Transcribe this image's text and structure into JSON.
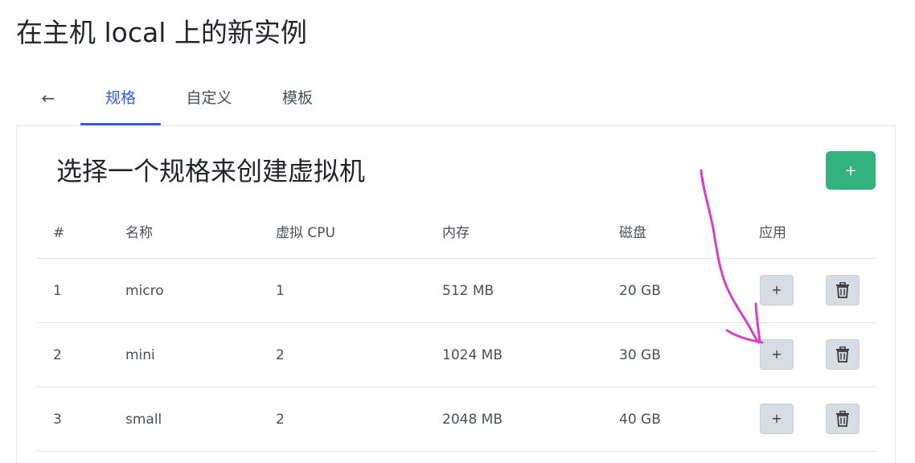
{
  "page": {
    "title": "在主机 local 上的新实例"
  },
  "tabs": {
    "back_label": "←",
    "items": [
      {
        "label": "规格"
      },
      {
        "label": "自定义"
      },
      {
        "label": "模板"
      }
    ],
    "active": "规格"
  },
  "card": {
    "title": "选择一个规格来创建虚拟机",
    "add_button_label": "+"
  },
  "table": {
    "headers": [
      "#",
      "名称",
      "虚拟 CPU",
      "内存",
      "磁盘",
      "应用"
    ],
    "rows": [
      {
        "index": "1",
        "name": "micro",
        "vcpu": "1",
        "memory": "512 MB",
        "disk": "20 GB"
      },
      {
        "index": "2",
        "name": "mini",
        "vcpu": "2",
        "memory": "1024 MB",
        "disk": "30 GB"
      },
      {
        "index": "3",
        "name": "small",
        "vcpu": "2",
        "memory": "2048 MB",
        "disk": "40 GB"
      }
    ],
    "apply_button_label": "+"
  },
  "icons": {
    "back": "arrow-left-icon",
    "delete": "trash-icon",
    "annotation": "hand-drawn-arrow"
  },
  "colors": {
    "accent": "#3b5bdb",
    "add_button": "#34b27b",
    "annotation": "#d63fc8",
    "row_button": "#d8dde3"
  }
}
